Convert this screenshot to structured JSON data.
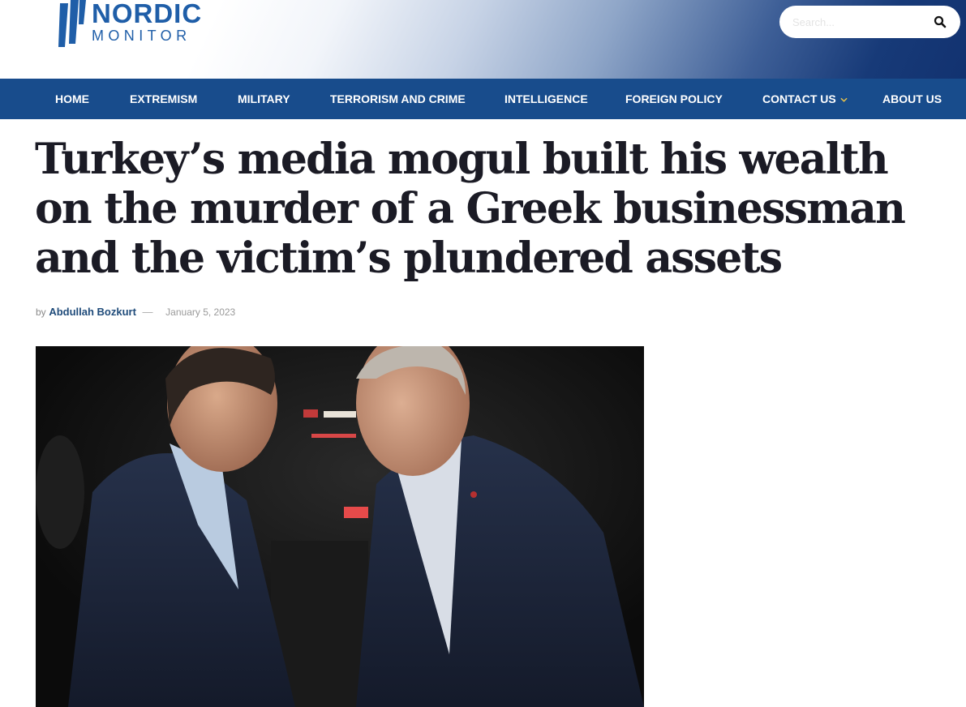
{
  "header": {
    "logo": {
      "line1": "NORDIC",
      "line2": "MONITOR",
      "icon": "logo-mark"
    },
    "search": {
      "placeholder": "Search...",
      "icon": "search-icon"
    }
  },
  "nav": {
    "items": [
      {
        "label": "HOME"
      },
      {
        "label": "EXTREMISM"
      },
      {
        "label": "MILITARY"
      },
      {
        "label": "TERRORISM AND CRIME"
      },
      {
        "label": "INTELLIGENCE"
      },
      {
        "label": "FOREIGN POLICY"
      },
      {
        "label": "CONTACT US",
        "icon": "chevron-down-icon"
      },
      {
        "label": "ABOUT US"
      }
    ]
  },
  "article": {
    "title": "Turkey’s media mogul built his wealth on the murder of a Greek businessman and the victim’s plundered assets",
    "meta": {
      "by": "by",
      "author": "Abdullah Bozkurt",
      "separator": "—",
      "date": "January 5, 2023"
    }
  },
  "colors": {
    "nav_bg": "#184c8c",
    "logo_blue": "#1f5ea8",
    "author_link": "#1f4b7a",
    "title_text": "#1b1b25"
  }
}
